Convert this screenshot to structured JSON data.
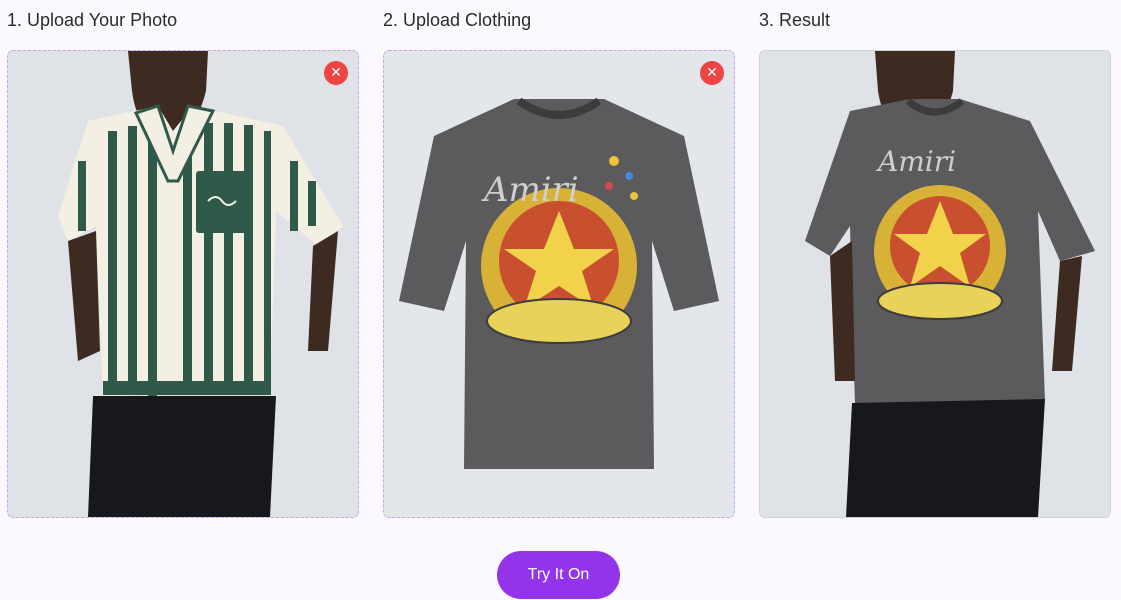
{
  "steps": [
    {
      "title": "1. Upload Your Photo",
      "image": "person-in-striped-shirt-photo",
      "remove_icon": "close-icon"
    },
    {
      "title": "2. Upload Clothing",
      "image": "graphic-tshirt-photo",
      "remove_icon": "close-icon"
    },
    {
      "title": "3. Result",
      "image": "person-wearing-graphic-tshirt-photo"
    }
  ],
  "action": {
    "label": "Try It On"
  },
  "colors": {
    "accent": "#9333ea",
    "remove": "#ef4444",
    "dashed_border": "#c9a4f2",
    "background": "#fbf9ff"
  }
}
